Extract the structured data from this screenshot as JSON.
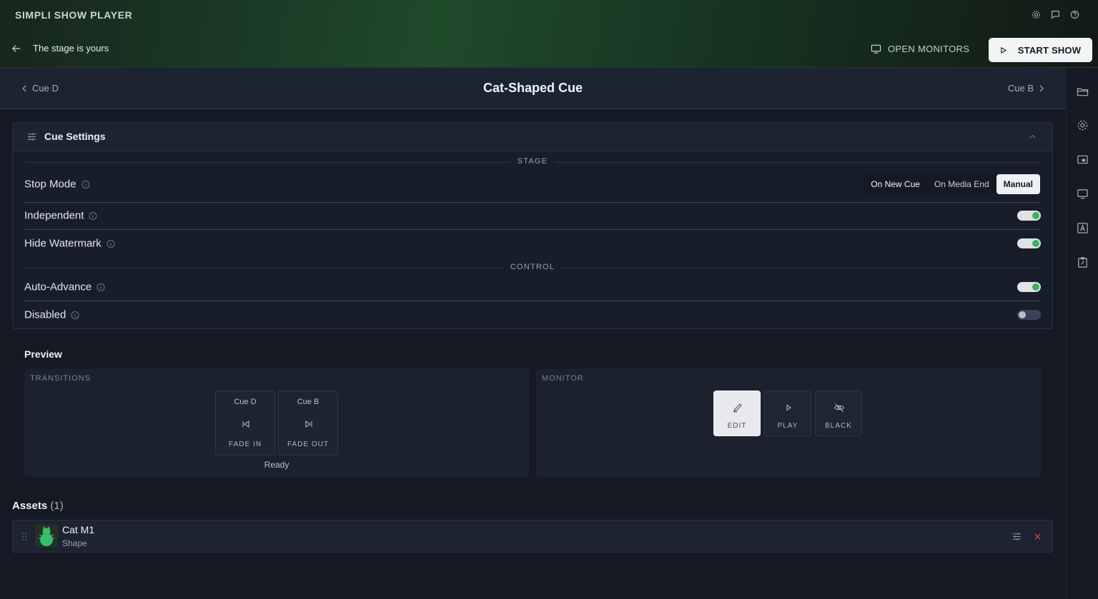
{
  "app": {
    "title": "SIMPLI SHOW PLAYER"
  },
  "top_icons": [
    "gear-icon",
    "chat-icon",
    "help-icon"
  ],
  "toolbar": {
    "back_label": "The stage is yours",
    "open_monitors_label": "OPEN MONITORS",
    "start_show_label": "START SHOW"
  },
  "cue_nav": {
    "prev_label": "Cue D",
    "title": "Cat-Shaped Cue",
    "next_label": "Cue B"
  },
  "cue_settings": {
    "title": "Cue Settings",
    "stage_section": "STAGE",
    "control_section": "CONTROL",
    "stop_mode": {
      "label": "Stop Mode",
      "options": [
        "On New Cue",
        "On Media End",
        "Manual"
      ],
      "selected": "Manual"
    },
    "independent": {
      "label": "Independent",
      "on": true
    },
    "hide_watermark": {
      "label": "Hide Watermark",
      "on": true
    },
    "auto_advance": {
      "label": "Auto-Advance",
      "on": true
    },
    "disabled": {
      "label": "Disabled",
      "on": false
    }
  },
  "preview": {
    "title": "Preview",
    "transitions": {
      "label": "TRANSITIONS",
      "fade_in": {
        "cue": "Cue D",
        "label": "FADE IN"
      },
      "fade_out": {
        "cue": "Cue B",
        "label": "FADE OUT"
      },
      "status": "Ready"
    },
    "monitor": {
      "label": "MONITOR",
      "buttons": [
        "EDIT",
        "PLAY",
        "BLACK"
      ],
      "active": "EDIT"
    }
  },
  "assets": {
    "title": "Assets",
    "count": "(1)",
    "items": [
      {
        "name": "Cat M1",
        "type": "Shape"
      }
    ]
  },
  "right_rail_icons": [
    "folder-icon",
    "settings-icon",
    "media-icon",
    "monitor-icon",
    "text-icon",
    "clipboard-icon"
  ],
  "colors": {
    "accent_green": "#3bb25d",
    "background": "#141923",
    "panel": "#181e29",
    "delete_red": "#e04848"
  }
}
